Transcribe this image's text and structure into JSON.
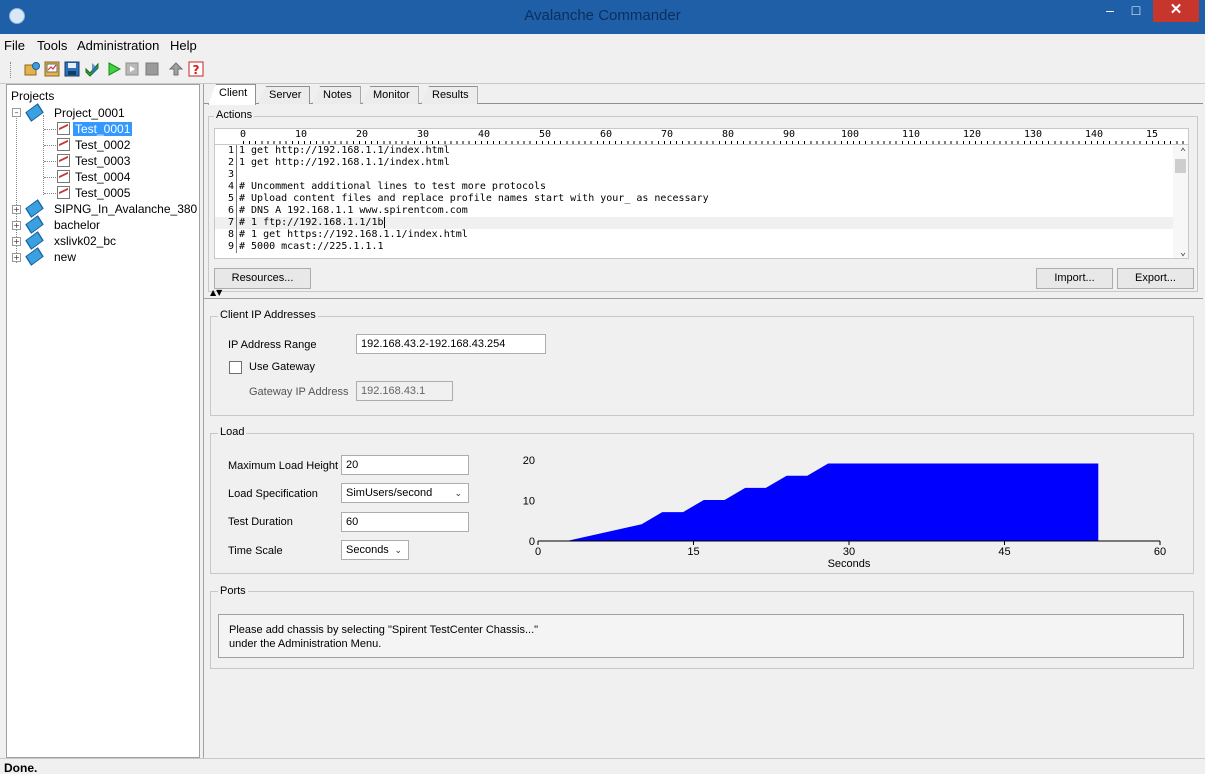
{
  "window": {
    "title": "Avalanche Commander"
  },
  "menu": [
    "File",
    "Tools",
    "Administration",
    "Help"
  ],
  "toolbar": {
    "icons": [
      "new-project-icon",
      "new-test-icon",
      "save-icon",
      "validate-icon",
      "run-icon",
      "stop-icon",
      "pause-icon",
      "upload-icon",
      "help-icon"
    ]
  },
  "tree": {
    "title": "Projects",
    "projects": [
      {
        "name": "Project_0001",
        "tests": [
          "Test_0001",
          "Test_0002",
          "Test_0003",
          "Test_0004",
          "Test_0005"
        ]
      },
      {
        "name": "SIPNG_In_Avalanche_380"
      },
      {
        "name": "bachelor"
      },
      {
        "name": "xslivk02_bc"
      },
      {
        "name": "new"
      }
    ]
  },
  "tabs": [
    "Client",
    "Server",
    "Notes",
    "Monitor",
    "Results"
  ],
  "actions": {
    "title": "Actions",
    "ruler": [
      "0",
      "10",
      "20",
      "30",
      "40",
      "50",
      "60",
      "70",
      "80",
      "90",
      "100",
      "110",
      "120",
      "130",
      "140",
      "15"
    ],
    "lines": [
      {
        "n": "1",
        "text": "1 get http://192.168.1.1/index.html"
      },
      {
        "n": "2",
        "text": "1 get http://192.168.1.1/index.html"
      },
      {
        "n": "3",
        "text": ""
      },
      {
        "n": "4",
        "text": "# Uncomment additional lines to test more protocols"
      },
      {
        "n": "5",
        "text": "# Upload content files and replace profile names start with your_ as necessary"
      },
      {
        "n": "6",
        "text": "# DNS A 192.168.1.1 www.spirentcom.com"
      },
      {
        "n": "7",
        "text": "# 1 ftp://192.168.1.1/1b"
      },
      {
        "n": "8",
        "text": "# 1 get https://192.168.1.1/index.html"
      },
      {
        "n": "9",
        "text": "# 5000 mcast://225.1.1.1"
      }
    ],
    "resources_button": "Resources...",
    "import_button": "Import...",
    "export_button": "Export..."
  },
  "client_ip": {
    "title": "Client IP Addresses",
    "range_label": "IP Address Range",
    "range_value": "192.168.43.2-192.168.43.254",
    "use_gateway_label": "Use Gateway",
    "use_gateway_checked": false,
    "gateway_label": "Gateway IP Address",
    "gateway_value": "192.168.43.1"
  },
  "load": {
    "title": "Load",
    "max_height_label": "Maximum Load Height",
    "max_height_value": "20",
    "spec_label": "Load Specification",
    "spec_value": "SimUsers/second",
    "duration_label": "Test Duration",
    "duration_value": "60",
    "timescale_label": "Time Scale",
    "timescale_value": "Seconds"
  },
  "chart_data": {
    "type": "area",
    "xlabel": "Seconds",
    "ylabel": "",
    "xlim": [
      0,
      60
    ],
    "ylim": [
      0,
      20
    ],
    "xticks": [
      0,
      15,
      30,
      45,
      60
    ],
    "yticks": [
      0,
      10,
      20
    ],
    "color": "#0000ff",
    "x": [
      0,
      3,
      3,
      10,
      12,
      12,
      14,
      16,
      16,
      18,
      20,
      20,
      22,
      24,
      24,
      26,
      28,
      28,
      54,
      54,
      60
    ],
    "y": [
      0,
      0,
      0,
      4,
      7,
      7,
      7,
      10,
      10,
      10,
      13,
      13,
      13,
      16,
      16,
      16,
      19,
      19,
      19,
      0,
      0
    ]
  },
  "ports": {
    "title": "Ports",
    "line1": "Please add chassis by selecting \"Spirent TestCenter Chassis...\"",
    "line2": "under the Administration Menu."
  },
  "status": "Done."
}
